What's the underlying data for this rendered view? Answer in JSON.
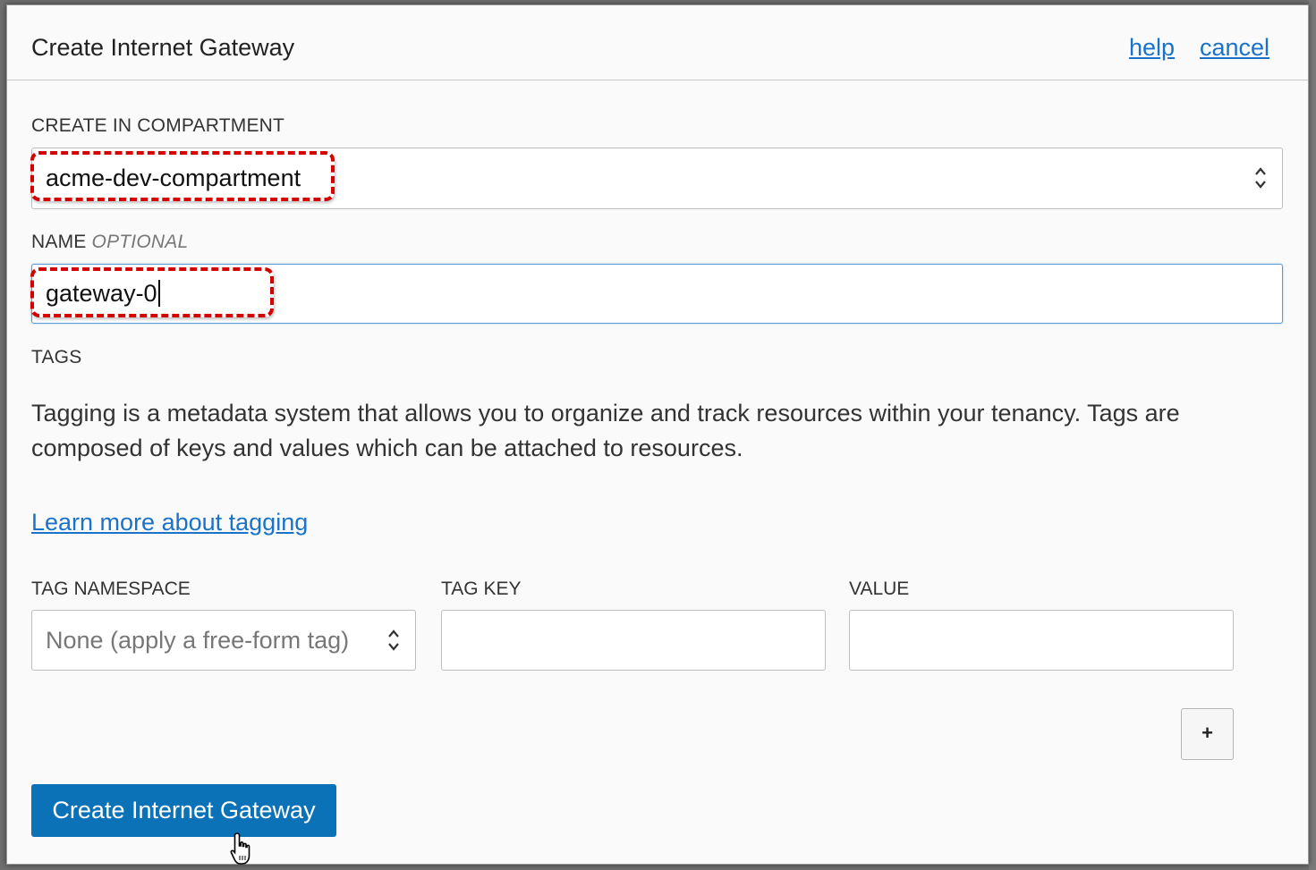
{
  "dialog": {
    "title": "Create Internet Gateway",
    "help_link": "help",
    "cancel_link": "cancel"
  },
  "compartment": {
    "label": "CREATE IN COMPARTMENT",
    "selected_value": "acme-dev-compartment"
  },
  "name": {
    "label": "NAME",
    "optional_label": "OPTIONAL",
    "value": "gateway-0"
  },
  "tags": {
    "label": "TAGS",
    "description": "Tagging is a metadata system that allows you to organize and track resources within your tenancy. Tags are composed of keys and values which can be attached to resources.",
    "learn_more_link": "Learn more about tagging",
    "namespace_label": "TAG NAMESPACE",
    "namespace_value": "None (apply a free-form tag)",
    "key_label": "TAG KEY",
    "key_value": "",
    "value_label": "VALUE",
    "value_value": "",
    "add_button": "+"
  },
  "submit_button": "Create Internet Gateway",
  "colors": {
    "primary": "#0c72b8",
    "link": "#1a73c9",
    "highlight": "#d60000"
  },
  "icons": {
    "select_chevron": "chevron-up-down-icon",
    "cursor": "hand-pointer-icon"
  }
}
